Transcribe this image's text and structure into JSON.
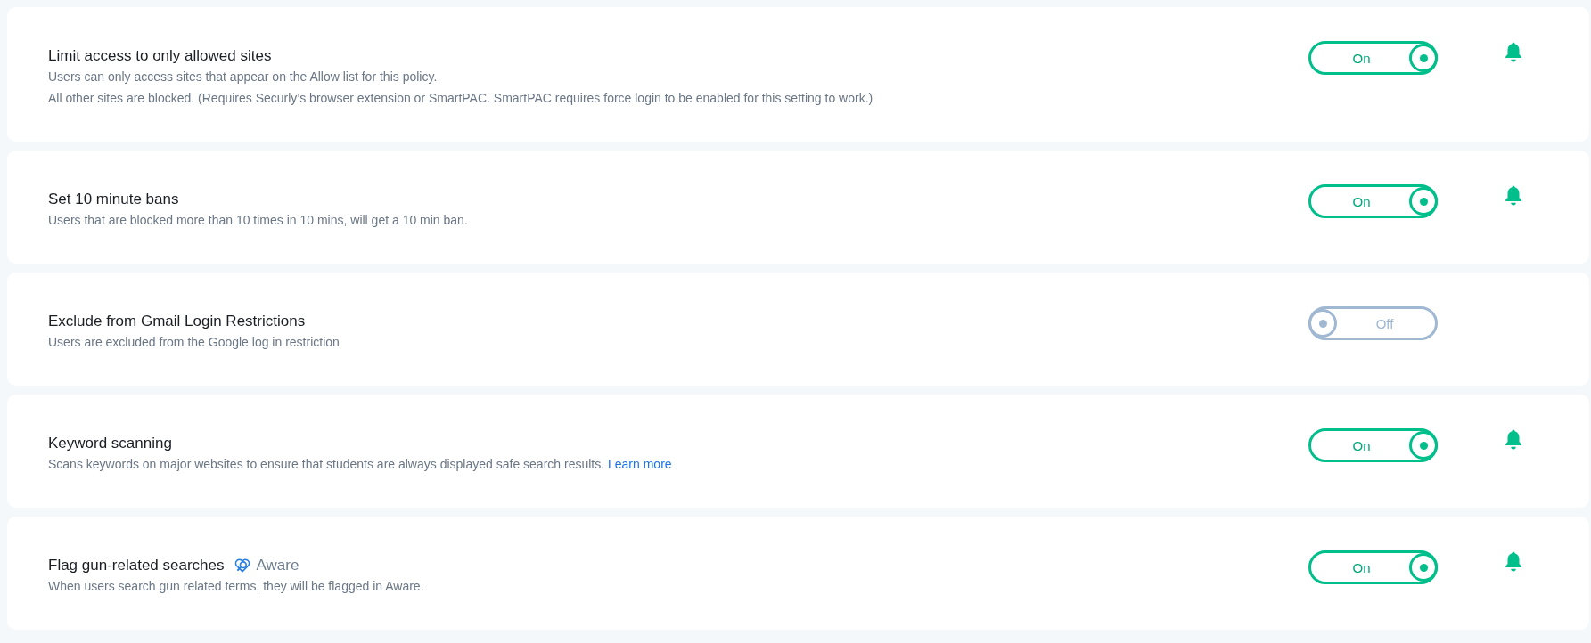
{
  "settings": [
    {
      "title": "Limit access to only allowed sites",
      "description": [
        "Users can only access sites that appear on the Allow list for this policy.",
        "All other sites are blocked. (Requires Securly’s browser extension or SmartPAC. SmartPAC requires force login to be enabled for this setting to work.)"
      ],
      "toggle": {
        "on": true,
        "label": "On"
      },
      "notify": true
    },
    {
      "title": "Set 10 minute bans",
      "description": [
        "Users that are blocked more than 10 times in 10 mins, will get a 10 min ban."
      ],
      "toggle": {
        "on": true,
        "label": "On"
      },
      "notify": true
    },
    {
      "title": "Exclude from Gmail Login Restrictions",
      "description": [
        "Users are excluded from the Google log in restriction"
      ],
      "toggle": {
        "on": false,
        "label": "Off"
      },
      "notify": false
    },
    {
      "title": "Keyword scanning",
      "description": [
        "Scans keywords on major websites to ensure that students are always displayed safe search results."
      ],
      "link": "Learn more",
      "toggle": {
        "on": true,
        "label": "On"
      },
      "notify": true
    },
    {
      "title": "Flag gun-related searches",
      "badge": "Aware",
      "description": [
        "When users search gun related terms, they will be flagged in Aware."
      ],
      "toggle": {
        "on": true,
        "label": "On"
      },
      "notify": true
    }
  ]
}
